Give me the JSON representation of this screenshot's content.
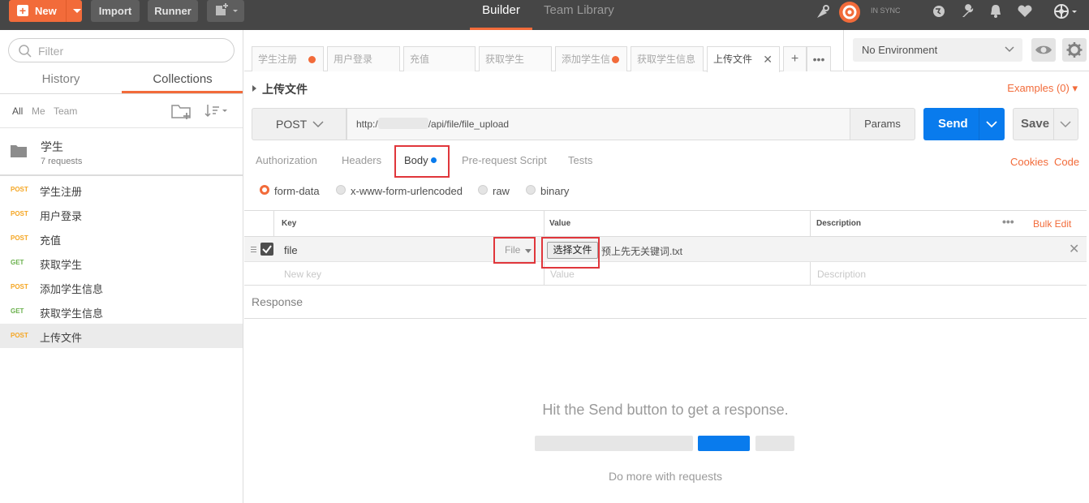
{
  "topbar": {
    "new_label": "New",
    "import_label": "Import",
    "runner_label": "Runner",
    "builder_tab": "Builder",
    "team_tab": "Team Library",
    "sync_status": "IN SYNC",
    "accent_color": "#f26b3a"
  },
  "sidebar": {
    "filter_placeholder": "Filter",
    "tabs": [
      "History",
      "Collections"
    ],
    "filters": [
      "All",
      "Me",
      "Team"
    ],
    "collection": {
      "name": "学生",
      "count": "7 requests"
    },
    "requests": [
      {
        "method": "POST",
        "name": "学生注册"
      },
      {
        "method": "POST",
        "name": "用户登录"
      },
      {
        "method": "POST",
        "name": "充值"
      },
      {
        "method": "GET",
        "name": "获取学生"
      },
      {
        "method": "POST",
        "name": "添加学生信息"
      },
      {
        "method": "GET",
        "name": "获取学生信息"
      },
      {
        "method": "POST",
        "name": "上传文件"
      }
    ]
  },
  "request_tabs": [
    "学生注册",
    "用户登录",
    "充值",
    "获取学生",
    "添加学生信",
    "获取学生信息",
    "上传文件"
  ],
  "environment": {
    "selected": "No Environment"
  },
  "request": {
    "title": "上传文件",
    "examples": "Examples (0)",
    "method": "POST",
    "url_prefix": "http:/",
    "url_suffix": "/api/file/file_upload",
    "params_label": "Params",
    "send_label": "Send",
    "save_label": "Save",
    "send_color": "#097bed"
  },
  "builder_tabs": [
    "Authorization",
    "Headers",
    "Body",
    "Pre-request Script",
    "Tests"
  ],
  "links": {
    "cookies": "Cookies",
    "code": "Code"
  },
  "body_modes": [
    "form-data",
    "x-www-form-urlencoded",
    "raw",
    "binary"
  ],
  "kv_table": {
    "headers": {
      "key": "Key",
      "value": "Value",
      "description": "Description",
      "bulk_edit": "Bulk Edit"
    },
    "row": {
      "key": "file",
      "type": "File",
      "choose_button": "选择文件",
      "file_name": "预上先无关键词.txt"
    },
    "placeholders": {
      "key": "New key",
      "value": "Value",
      "description": "Description"
    }
  },
  "response": {
    "title": "Response",
    "hint": "Hit the Send button to get a response.",
    "more": "Do more with requests"
  }
}
